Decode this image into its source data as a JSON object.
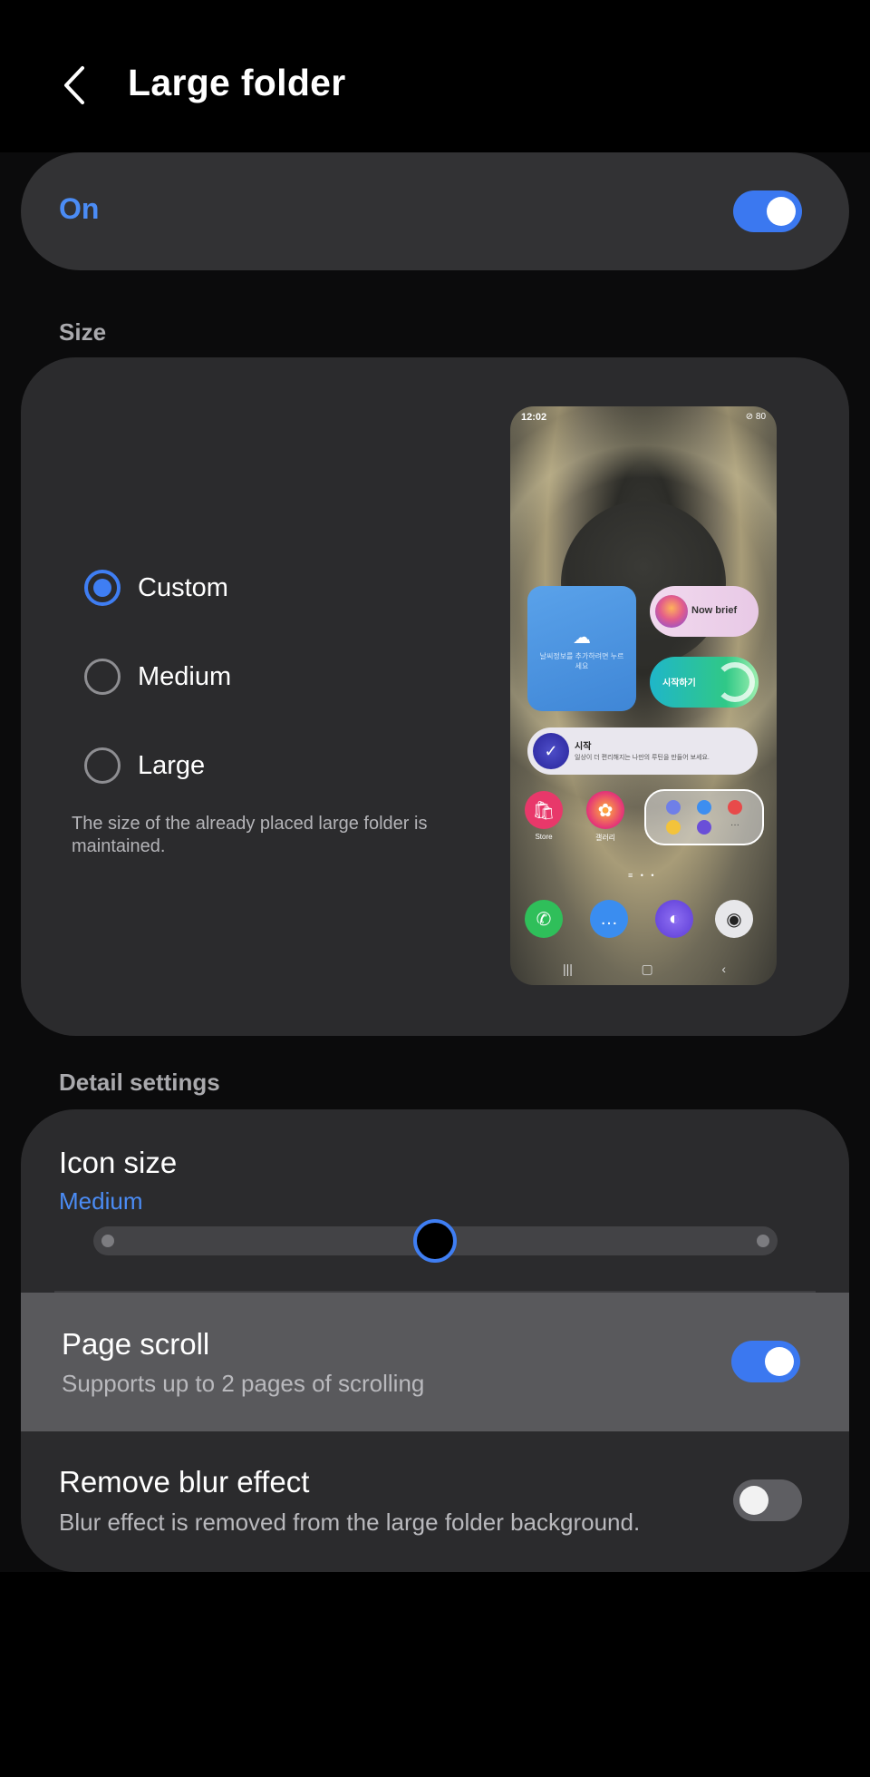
{
  "header": {
    "title": "Large folder"
  },
  "master": {
    "label": "On",
    "enabled": true
  },
  "size_section": {
    "label": "Size",
    "options": [
      {
        "label": "Custom",
        "checked": true
      },
      {
        "label": "Medium",
        "checked": false
      },
      {
        "label": "Large",
        "checked": false
      }
    ],
    "note": "The size of the already placed large folder is maintained.",
    "preview": {
      "time": "12:02",
      "status_icons": "⊘ 80",
      "weather_text": "날씨정보를 추가하려면 누르세요",
      "now_brief": "Now brief",
      "start_widget": "시작하기",
      "routine_title": "시작",
      "routine_sub": "일상이 더 편리해지는 나만의 루틴을 만들어 보세요.",
      "app_store": "Store",
      "app_gallery": "갤러리"
    }
  },
  "detail_section": {
    "label": "Detail settings",
    "icon_size": {
      "title": "Icon size",
      "value": "Medium",
      "level": 0.5
    },
    "page_scroll": {
      "title": "Page scroll",
      "subtitle": "Supports up to 2 pages of scrolling",
      "enabled": true
    },
    "remove_blur": {
      "title": "Remove blur effect",
      "subtitle": "Blur effect is removed from the large folder background.",
      "enabled": false
    }
  },
  "colors": {
    "accent": "#3f7ef3",
    "accent_text": "#4b8cf5",
    "card": "#2b2b2d",
    "background": "#0b0b0c"
  }
}
